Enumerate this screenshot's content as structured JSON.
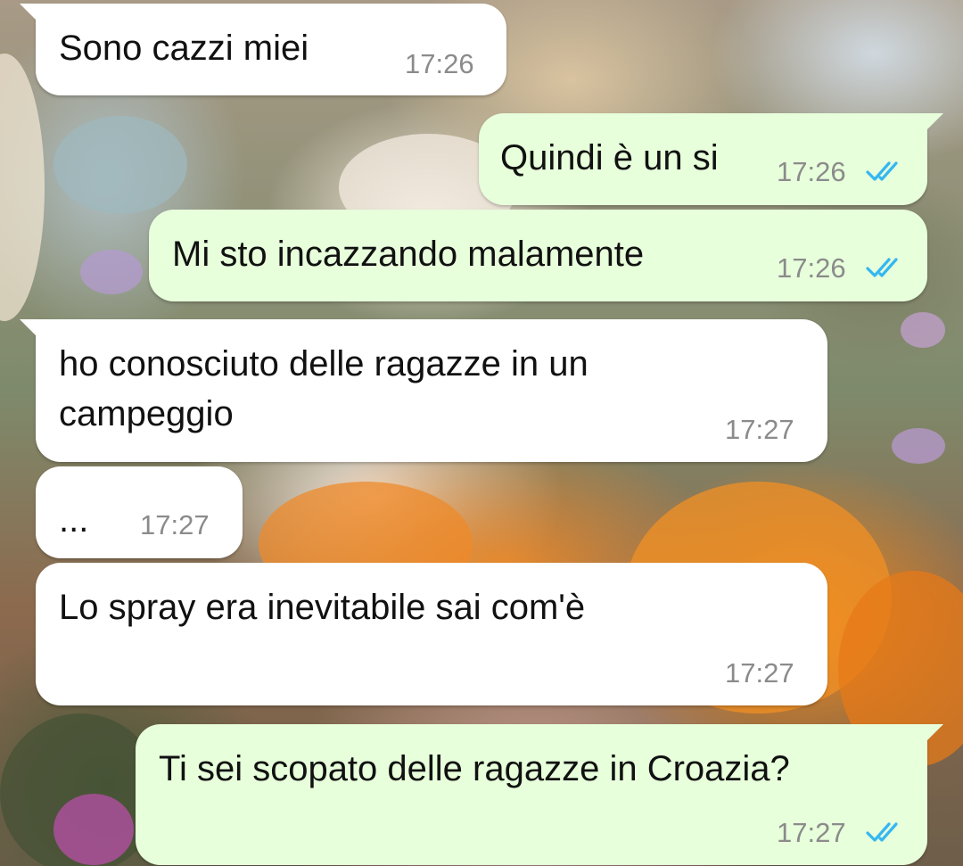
{
  "conversation": {
    "messages": [
      {
        "direction": "incoming",
        "text": "Sono cazzi miei",
        "time": "17:26"
      },
      {
        "direction": "outgoing",
        "text": "Quindi è un si",
        "time": "17:26",
        "status": "read",
        "status_icon": "double-check-icon"
      },
      {
        "direction": "outgoing",
        "text": "Mi sto incazzando malamente",
        "time": "17:26",
        "status": "read",
        "status_icon": "double-check-icon"
      },
      {
        "direction": "incoming",
        "text_lines": [
          "ho conosciuto delle ragazze in un",
          "campeggio"
        ],
        "time": "17:27"
      },
      {
        "direction": "incoming",
        "text": "...",
        "time": "17:27"
      },
      {
        "direction": "incoming",
        "text": "Lo spray era inevitabile sai com'è",
        "time": "17:27"
      },
      {
        "direction": "outgoing",
        "text": "Ti sei scopato delle ragazze in Croazia?",
        "time": "17:27",
        "status": "read",
        "status_icon": "double-check-icon"
      }
    ]
  },
  "colors": {
    "incoming_bubble": "#ffffff",
    "outgoing_bubble": "#e7ffdb",
    "text": "#111111",
    "timestamp": "#8b8b8b",
    "read_ticks": "#34b7f1"
  }
}
